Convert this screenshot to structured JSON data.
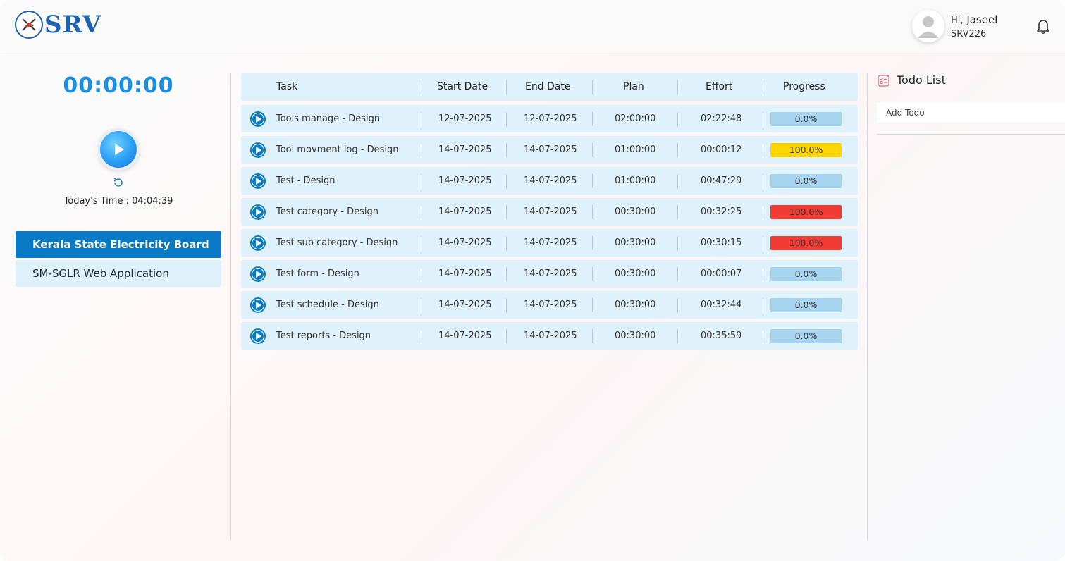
{
  "header": {
    "brand": "SRV",
    "greeting_prefix": "Hi,",
    "user_name": "Jaseel",
    "user_id": "SRV226",
    "icons": {
      "avatar": "user-avatar-icon",
      "notifications": "bell-icon"
    }
  },
  "timer": {
    "display": "00:00:00",
    "today_label": "Today's Time : 04:04:39"
  },
  "projects": [
    {
      "label": "Kerala State Electricity Board",
      "active": true
    },
    {
      "label": "SM-SGLR Web Application",
      "active": false
    }
  ],
  "table": {
    "headers": {
      "task": "Task",
      "start": "Start Date",
      "end": "End Date",
      "plan": "Plan",
      "effort": "Effort",
      "progress": "Progress"
    },
    "rows": [
      {
        "task": "Tools manage - Design",
        "start": "12-07-2025",
        "end": "12-07-2025",
        "plan": "02:00:00",
        "effort": "02:22:48",
        "progress": "0.0%",
        "progress_color": "#a6d3ee"
      },
      {
        "task": "Tool movment log - Design",
        "start": "14-07-2025",
        "end": "14-07-2025",
        "plan": "01:00:00",
        "effort": "00:00:12",
        "progress": "100.0%",
        "progress_color": "#ffd600"
      },
      {
        "task": "Test - Design",
        "start": "14-07-2025",
        "end": "14-07-2025",
        "plan": "01:00:00",
        "effort": "00:47:29",
        "progress": "0.0%",
        "progress_color": "#a6d3ee"
      },
      {
        "task": "Test category - Design",
        "start": "14-07-2025",
        "end": "14-07-2025",
        "plan": "00:30:00",
        "effort": "00:32:25",
        "progress": "100.0%",
        "progress_color": "#ef3b32"
      },
      {
        "task": "Test sub category - Design",
        "start": "14-07-2025",
        "end": "14-07-2025",
        "plan": "00:30:00",
        "effort": "00:30:15",
        "progress": "100.0%",
        "progress_color": "#ef3b32"
      },
      {
        "task": "Test form - Design",
        "start": "14-07-2025",
        "end": "14-07-2025",
        "plan": "00:30:00",
        "effort": "00:00:07",
        "progress": "0.0%",
        "progress_color": "#a6d3ee"
      },
      {
        "task": "Test schedule - Design",
        "start": "14-07-2025",
        "end": "14-07-2025",
        "plan": "00:30:00",
        "effort": "00:32:44",
        "progress": "0.0%",
        "progress_color": "#a6d3ee"
      },
      {
        "task": "Test reports - Design",
        "start": "14-07-2025",
        "end": "14-07-2025",
        "plan": "00:30:00",
        "effort": "00:35:59",
        "progress": "0.0%",
        "progress_color": "#a6d3ee"
      }
    ]
  },
  "todo": {
    "title": "Todo List",
    "input_placeholder": "Add Todo"
  },
  "colors": {
    "accent": "#0979c3",
    "timer": "#1a8fe0",
    "row_bg": "#dff1fb"
  }
}
